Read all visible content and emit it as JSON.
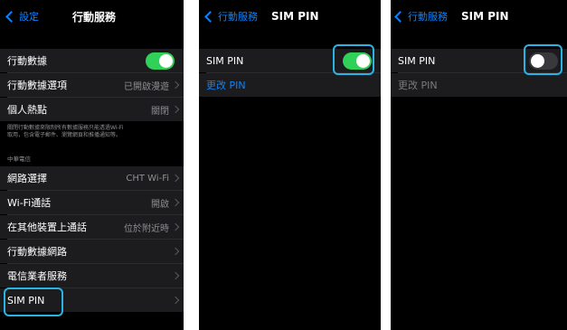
{
  "panel1": {
    "back_label": "設定",
    "title": "行動服務",
    "rows": [
      {
        "label": "行動數據",
        "value": null
      },
      {
        "label": "行動數據選項",
        "value": "已開啟漫遊"
      },
      {
        "label": "個人熱點",
        "value": "關閉"
      }
    ],
    "footnote_line1": "關閉行動數據來限制所有數據服務只能透過Wi-Fi",
    "footnote_line2": "取用，包含電子郵件、瀏覽網頁和推播通知等。",
    "carrier_header": "中華電信",
    "carrier_rows": [
      {
        "label": "網路選擇",
        "value": "CHT Wi-Fi"
      },
      {
        "label": "Wi-Fi通話",
        "value": "開啟"
      },
      {
        "label": "在其他裝置上通話",
        "value": "位於附近時"
      },
      {
        "label": "行動數據網路",
        "value": ""
      },
      {
        "label": "電信業者服務",
        "value": ""
      },
      {
        "label": "SIM PIN",
        "value": ""
      }
    ],
    "cellular_data_toggle": "on"
  },
  "panel2": {
    "back_label": "行動服務",
    "title": "SIM PIN",
    "sim_pin_label": "SIM PIN",
    "change_pin_label": "更改 PIN",
    "toggle": "on"
  },
  "panel3": {
    "back_label": "行動服務",
    "title": "SIM PIN",
    "sim_pin_label": "SIM PIN",
    "change_pin_label": "更改 PIN",
    "toggle": "off"
  },
  "colors": {
    "highlight": "#2bb3e6",
    "toggle_on": "#30d158",
    "link": "#0a84ff"
  }
}
